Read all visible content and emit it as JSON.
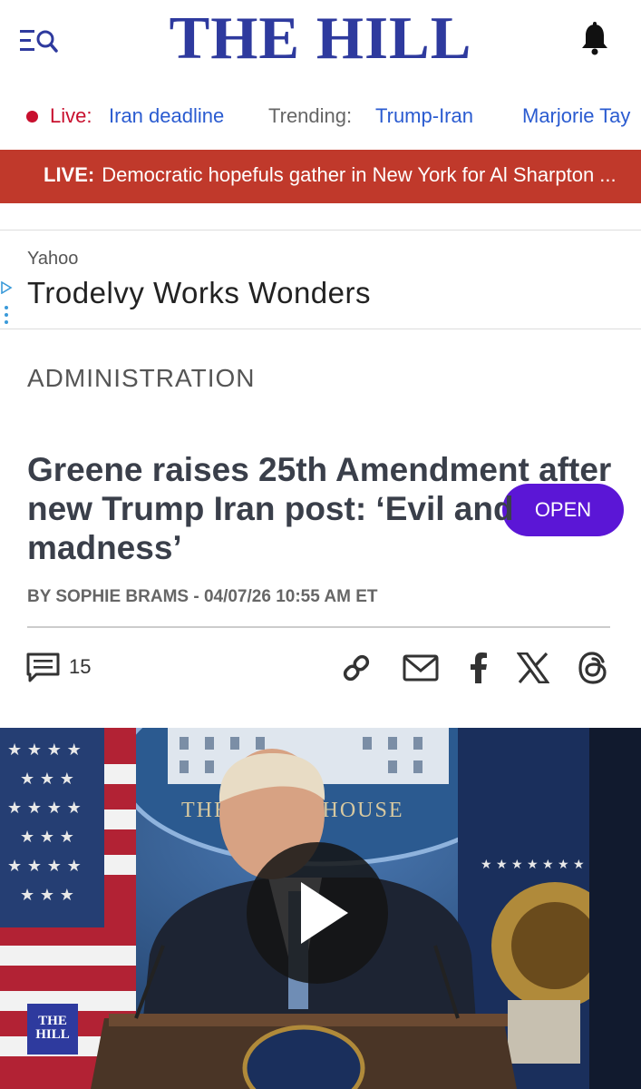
{
  "header": {
    "logo": "THE HILL",
    "menu_icon": "search-menu-icon",
    "bell_icon": "bell-icon"
  },
  "nav": {
    "live_label": "Live:",
    "live_link": "Iran deadline",
    "trending_label": "Trending:",
    "trending_links": [
      "Trump-Iran",
      "Marjorie Tay"
    ]
  },
  "live_banner": {
    "tag": "LIVE:",
    "text": "Democratic hopefuls gather in New York for Al Sharpton ..."
  },
  "ad": {
    "source": "Yahoo",
    "headline": "Trodelvy Works Wonders",
    "button": "OPEN"
  },
  "article": {
    "category": "ADMINISTRATION",
    "title": "Greene raises 25th Amendment after new Trump Iran post: ‘Evil and madness’",
    "byline": "BY SOPHIE BRAMS - 04/07/26 10:55 AM ET",
    "comment_count": "15"
  },
  "video": {
    "podium_text": "THE WHITE HOUSE",
    "badge": "THE HILL"
  },
  "colors": {
    "brand_blue": "#2e3a9e",
    "live_red": "#c8102e",
    "banner_red": "#c0392b",
    "link_blue": "#2a5bd0",
    "ad_button": "#5b16d6"
  }
}
